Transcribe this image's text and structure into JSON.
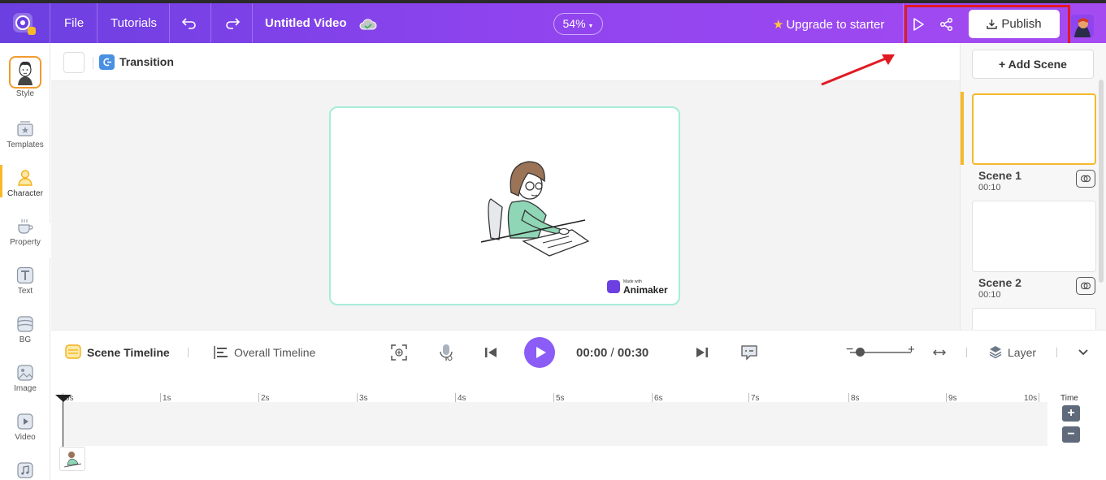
{
  "topbar": {
    "file_label": "File",
    "tutorials_label": "Tutorials",
    "video_title": "Untitled Video",
    "zoom": "54%",
    "upgrade_label": "Upgrade to starter",
    "publish_label": "Publish"
  },
  "sidebar": {
    "items": [
      {
        "label": "Style"
      },
      {
        "label": "Templates"
      },
      {
        "label": "Character"
      },
      {
        "label": "Property"
      },
      {
        "label": "Text"
      },
      {
        "label": "BG"
      },
      {
        "label": "Image"
      },
      {
        "label": "Video"
      }
    ],
    "active": "Character"
  },
  "canvas": {
    "transition_label": "Transition",
    "watermark_small": "Made with",
    "watermark_brand": "Animaker"
  },
  "scenes": {
    "add_label": "+ Add Scene",
    "list": [
      {
        "name": "Scene 1",
        "duration": "00:10"
      },
      {
        "name": "Scene 2",
        "duration": "00:10"
      }
    ]
  },
  "timeline": {
    "scene_timeline_label": "Scene Timeline",
    "overall_timeline_label": "Overall Timeline",
    "current_time": "00:00",
    "separator": "/",
    "total_time": "00:30",
    "layer_label": "Layer",
    "time_label": "Time",
    "ticks": [
      "0s",
      "1s",
      "2s",
      "3s",
      "4s",
      "5s",
      "6s",
      "7s",
      "8s",
      "9s",
      "10s"
    ]
  },
  "colors": {
    "brand_purple": "#8b5cf6",
    "accent_yellow": "#f5b92a",
    "highlight_red": "#e01a23"
  }
}
